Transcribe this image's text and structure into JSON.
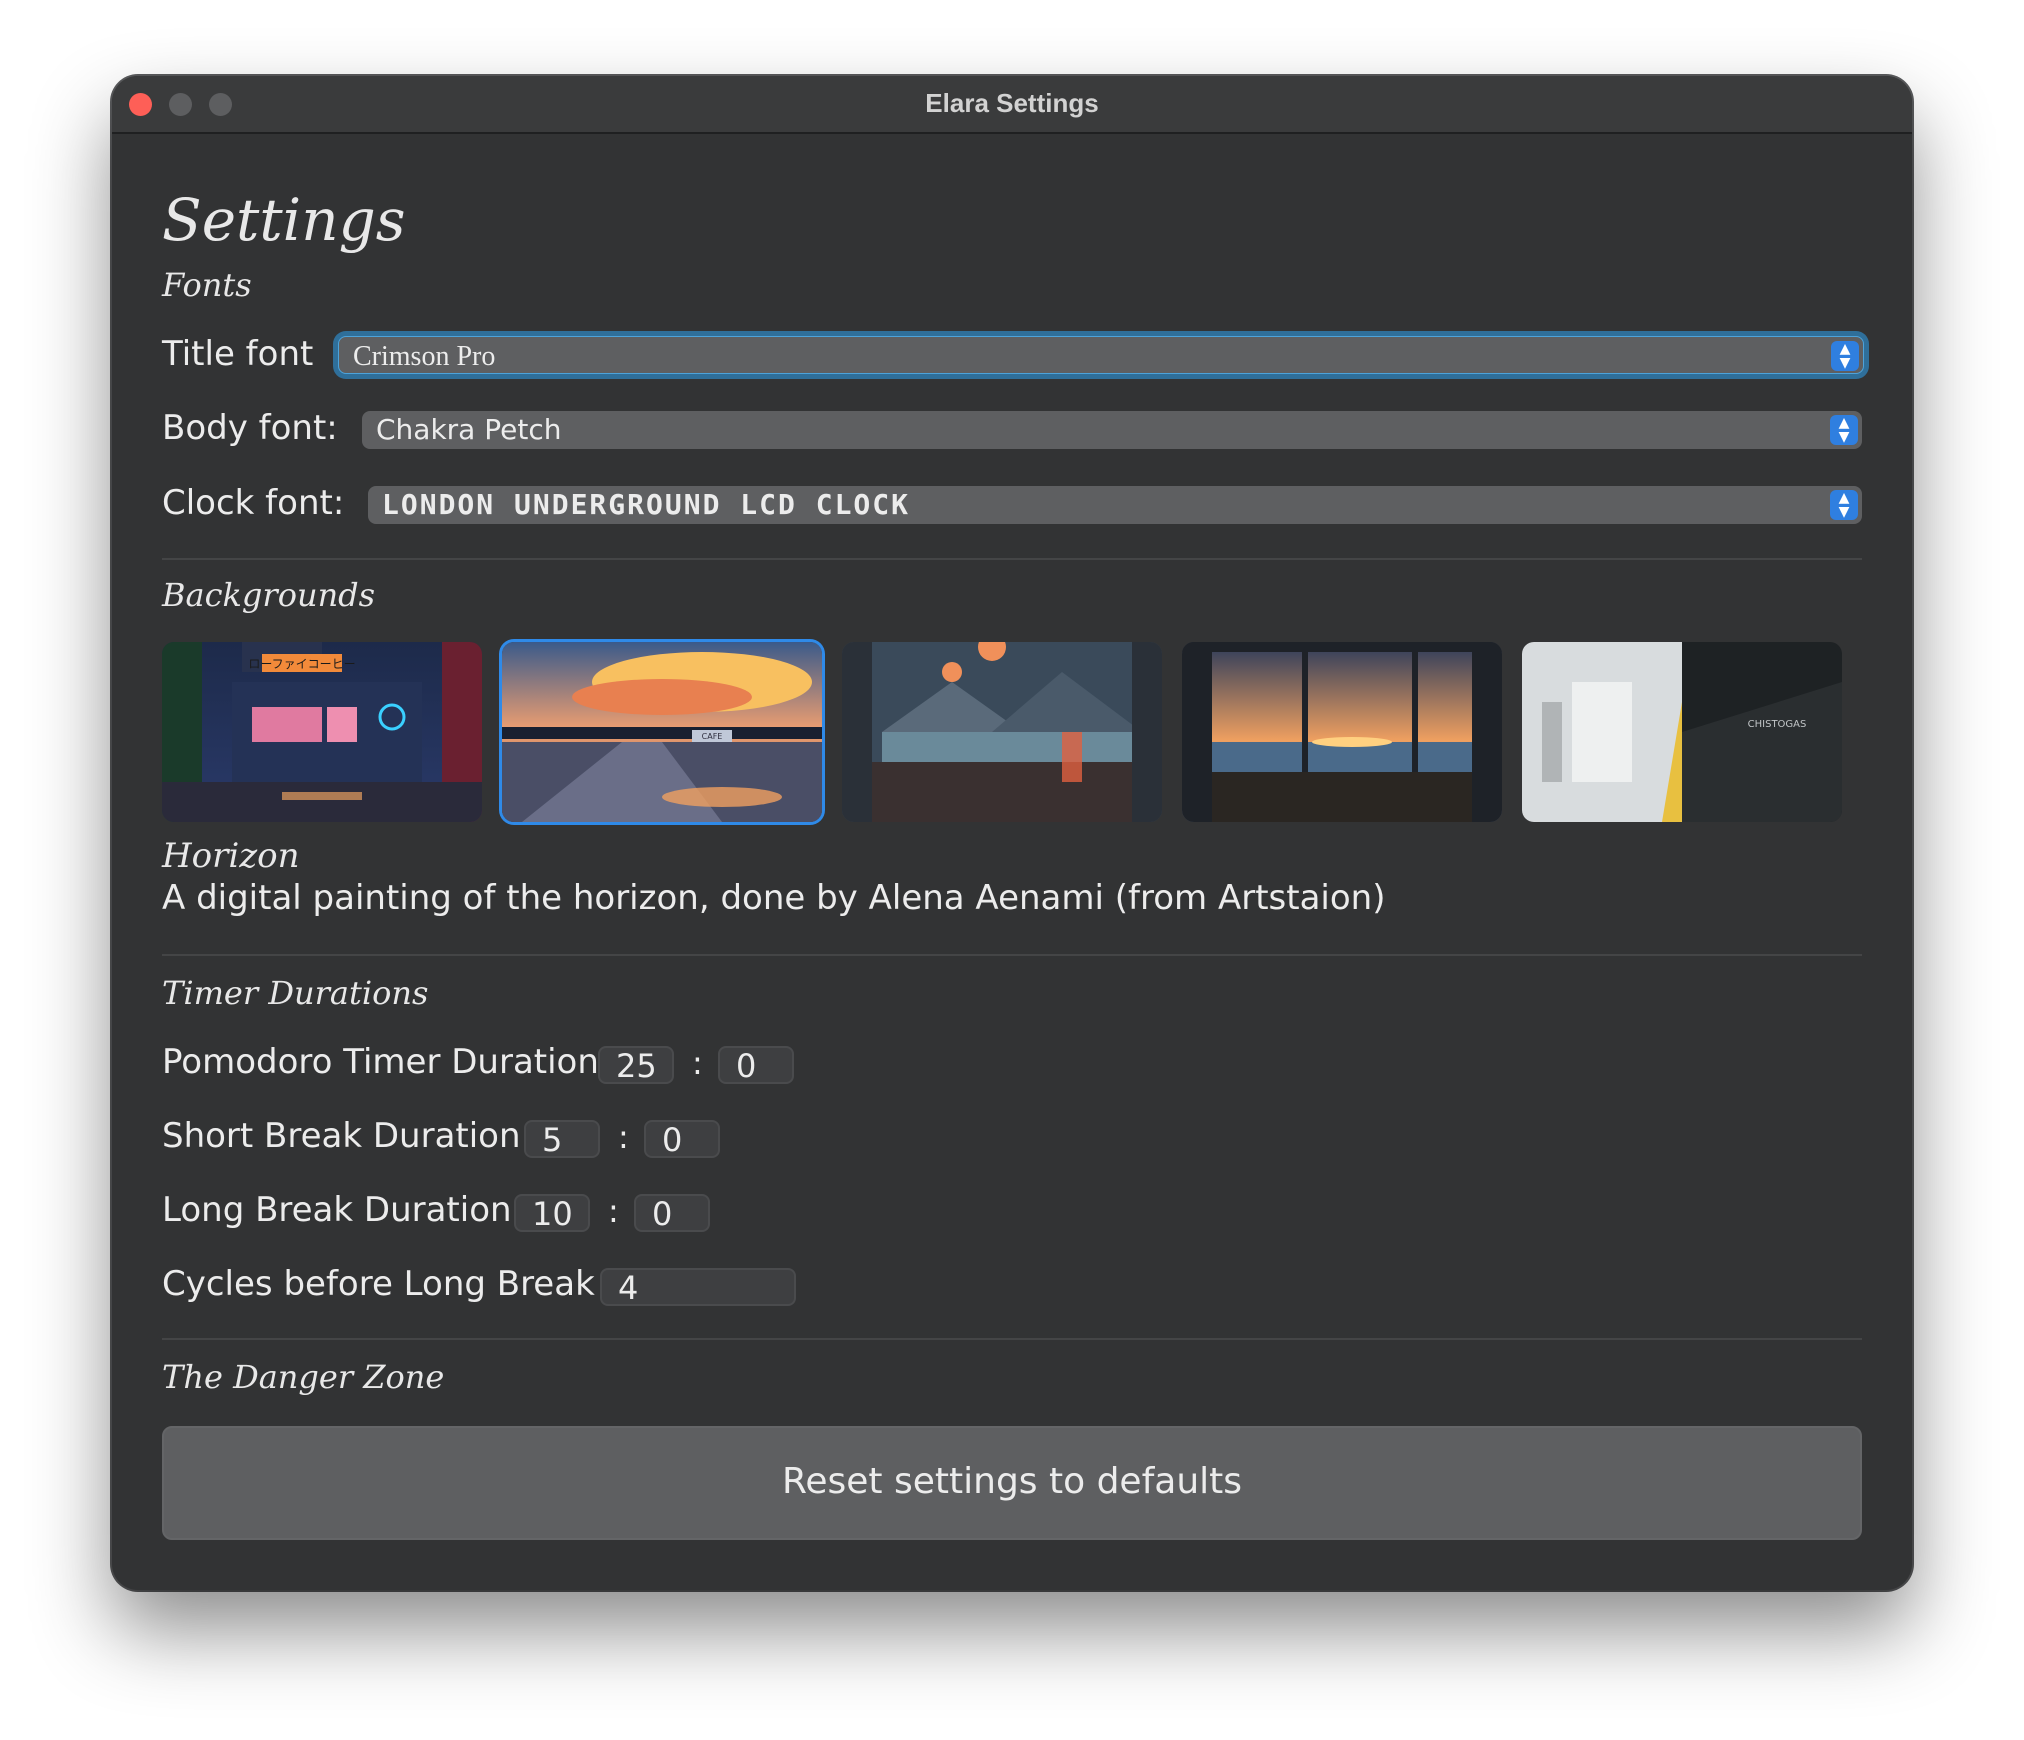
{
  "window": {
    "title": "Elara Settings"
  },
  "page": {
    "title": "Settings"
  },
  "fonts": {
    "section_title": "Fonts",
    "title_font": {
      "label": "Title font",
      "value": "Crimson Pro"
    },
    "body_font": {
      "label": "Body font:",
      "value": "Chakra Petch"
    },
    "clock_font": {
      "label": "Clock font:",
      "value": "LONDON UNDERGROUND LCD CLOCK"
    }
  },
  "backgrounds": {
    "section_title": "Backgrounds",
    "selected_index": 1,
    "selected_title": "Horizon",
    "selected_description": "A digital painting of the horizon, done by Alena Aenami (from Artstaion)",
    "signage": {
      "cafe": "ローファイコーヒー",
      "horizon_sign": "CAFE",
      "subway_sign": "CHISTOGAS"
    }
  },
  "timers": {
    "section_title": "Timer Durations",
    "pomodoro": {
      "label": "Pomodoro Timer Duration",
      "minutes": "25",
      "seconds": "0"
    },
    "short_break": {
      "label": "Short Break Duration",
      "minutes": "5",
      "seconds": "0"
    },
    "long_break": {
      "label": "Long Break Duration",
      "minutes": "10",
      "seconds": "0"
    },
    "cycles": {
      "label": "Cycles before Long Break",
      "value": "4"
    },
    "separator": ":"
  },
  "danger": {
    "section_title": "The Danger Zone",
    "reset_label": "Reset settings to defaults"
  },
  "colors": {
    "window_bg": "#323334",
    "accent": "#2f7fe0",
    "close": "#fe5f57"
  }
}
